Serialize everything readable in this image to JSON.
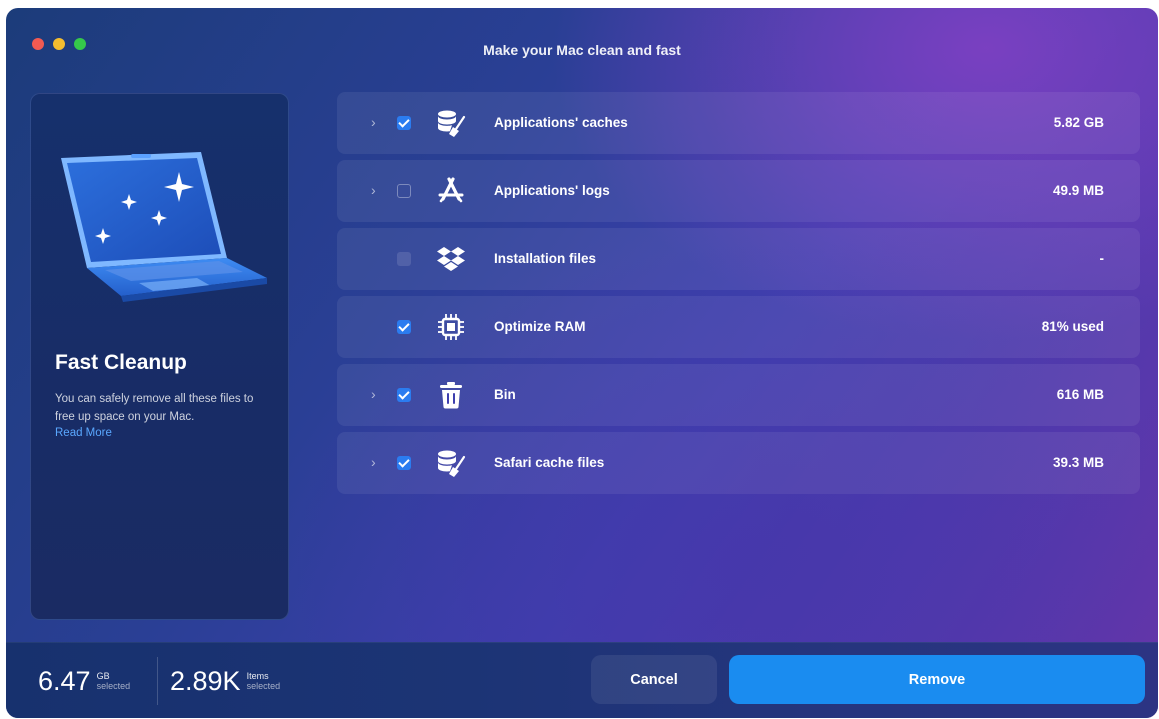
{
  "window": {
    "title": "Make your Mac clean and fast"
  },
  "sidebar": {
    "title": "Fast Cleanup",
    "description": "You can safely remove all these files to free up space on your Mac.",
    "read_more": "Read More",
    "illustration": "laptop-sparkle-illustration"
  },
  "rows": [
    {
      "label": "Applications' caches",
      "value": "5.82 GB",
      "checked": true,
      "expandable": true,
      "icon": "database-broom-icon"
    },
    {
      "label": "Applications' logs",
      "value": "49.9 MB",
      "checked": false,
      "expandable": true,
      "icon": "app-store-icon"
    },
    {
      "label": "Installation files",
      "value": "-",
      "checked": null,
      "expandable": false,
      "icon": "dropbox-box-icon"
    },
    {
      "label": "Optimize RAM",
      "value": "81% used",
      "checked": true,
      "expandable": false,
      "icon": "chip-icon"
    },
    {
      "label": "Bin",
      "value": "616 MB",
      "checked": true,
      "expandable": true,
      "icon": "trash-icon"
    },
    {
      "label": "Safari cache files",
      "value": "39.3 MB",
      "checked": true,
      "expandable": true,
      "icon": "database-broom-icon"
    }
  ],
  "footer": {
    "size": {
      "value": "6.47",
      "unit": "GB",
      "sub": "selected"
    },
    "items": {
      "value": "2.89K",
      "unit": "Items",
      "sub": "selected"
    },
    "cancel_label": "Cancel",
    "remove_label": "Remove"
  },
  "colors": {
    "accent": "#1a8cf0",
    "checkbox": "#2b7cf0",
    "link": "#5aa8ff"
  }
}
